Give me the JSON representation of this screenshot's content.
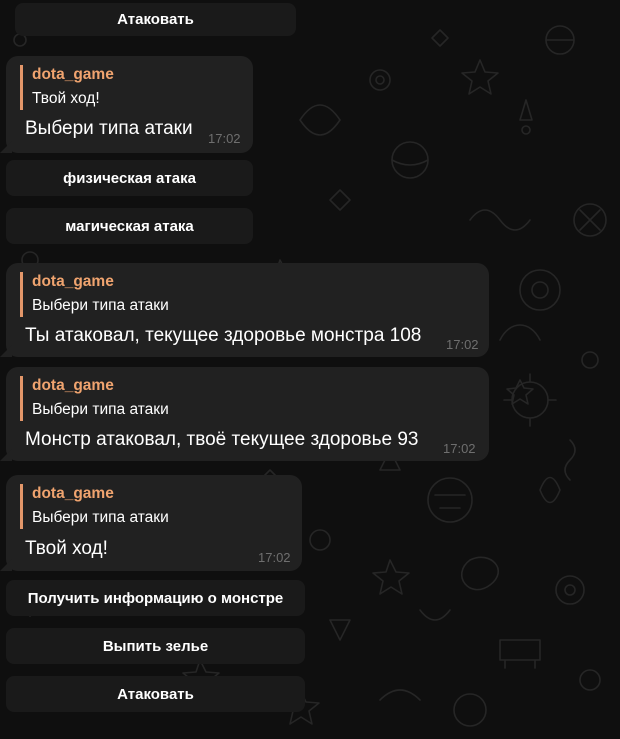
{
  "top_keyboard": {
    "attack_label": "Атаковать"
  },
  "messages": [
    {
      "reply_author": "dota_game",
      "reply_text": "Твой ход!",
      "text": "Выбери типа атаки",
      "time": "17:02"
    },
    {
      "reply_author": "dota_game",
      "reply_text": "Выбери типа атаки",
      "text": "Ты атаковал, текущее здоровье монстра 108",
      "time": "17:02"
    },
    {
      "reply_author": "dota_game",
      "reply_text": "Выбери типа атаки",
      "text": "Монстр атаковал, твоё текущее здоровье 93",
      "time": "17:02"
    },
    {
      "reply_author": "dota_game",
      "reply_text": "Выбери типа атаки",
      "text": "Твой ход!",
      "time": "17:02"
    }
  ],
  "attack_keyboard": {
    "physical_label": "физическая атака",
    "magic_label": "магическая атака"
  },
  "main_keyboard": {
    "monster_info_label": "Получить информацию о монстре",
    "potion_label": "Выпить зелье",
    "attack_label": "Атаковать"
  },
  "colors": {
    "background": "#0f0f0f",
    "bubble": "#212121",
    "button": "#1a1a1a",
    "accent_name": "#f0a46f",
    "reply_bar": "#e3976a",
    "time": "#6f6f6f"
  }
}
